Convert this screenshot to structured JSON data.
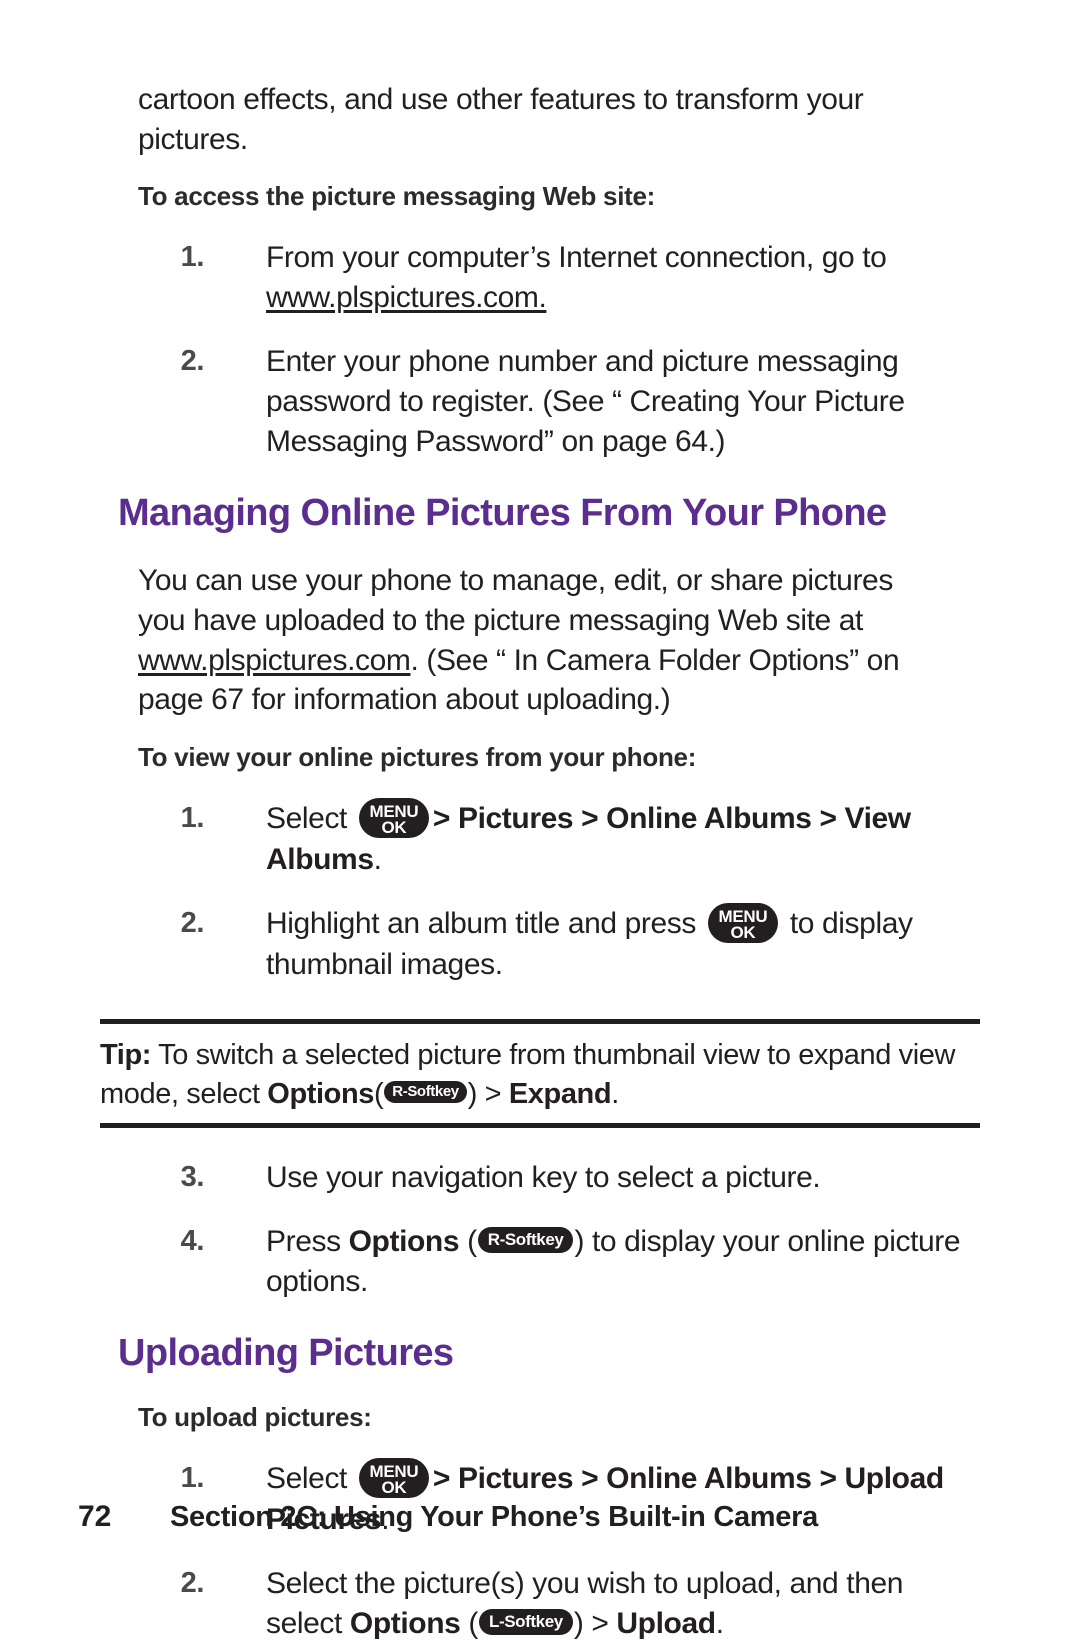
{
  "document": {
    "intro_continuation": "cartoon effects, and use other features to transform your pictures.",
    "intro_lead_in": "To access the picture messaging Web site:",
    "intro_steps": [
      {
        "number": "1.",
        "text_before": "From your computer’s Internet connection, go to ",
        "link": "www.plspictures.com.",
        "text_after": ""
      },
      {
        "number": "2.",
        "text_before": "Enter your phone number and picture messaging password to register. (See “ Creating Your Picture Messaging Password”  on page 64.)",
        "link": "",
        "text_after": ""
      }
    ],
    "managing_section": {
      "heading": "Managing Online Pictures From Your Phone",
      "paragraph_part1": "You can use your phone to manage, edit, or share pictures you have uploaded to the picture messaging Web site at ",
      "paragraph_link": "www.plspictures.com",
      "paragraph_part2": ". (See “ In Camera Folder Options”  on page 67 for information about uploading.)",
      "lead_in": "To view your online pictures from your phone:",
      "step1": {
        "number": "1.",
        "prefix": "Select ",
        "key_line1": "MENU",
        "key_line2": "OK",
        "path": "> Pictures > Online Albums > View Albums",
        "suffix": "."
      },
      "step2": {
        "number": "2.",
        "prefix": "Highlight an album title and press ",
        "key_line1": "MENU",
        "key_line2": "OK",
        "suffix": " to display thumbnail images."
      },
      "tip": {
        "label": "Tip:",
        "text_before": " To switch a selected picture from thumbnail view to expand view mode, select ",
        "bold_options": "Options",
        "paren_open": "(",
        "key_label": "R-Softkey",
        "paren_close": ")",
        "separator": " > ",
        "bold_expand": "Expand",
        "period": "."
      },
      "step3": {
        "number": "3.",
        "text": "Use your navigation key to select a picture."
      },
      "step4": {
        "number": "4.",
        "prefix": "Press ",
        "bold_options": "Options",
        "paren_open": " (",
        "key_label": "R-Softkey",
        "paren_close": ")",
        "suffix": " to display your online picture options."
      }
    },
    "uploading_section": {
      "heading": "Uploading Pictures",
      "lead_in": "To upload pictures:",
      "step1": {
        "number": "1.",
        "prefix": "Select ",
        "key_line1": "MENU",
        "key_line2": "OK",
        "path": "> Pictures > Online Albums > Upload Pictures",
        "suffix": "."
      },
      "step2": {
        "number": "2.",
        "text": "Select the picture(s) you wish to upload, and then select ",
        "bold_options": "Options",
        "paren_open": " (",
        "key_label": "L-Softkey",
        "paren_close": ")",
        "separator": " > ",
        "bold_upload": "Upload",
        "period": "."
      }
    },
    "footer": {
      "page_number": "72",
      "title": "Section 2C: Using Your Phone’s Built-in Camera"
    },
    "colors": {
      "heading_purple": "#5b2d8e",
      "body_text": "#231f20",
      "key_background": "#231f20"
    }
  }
}
